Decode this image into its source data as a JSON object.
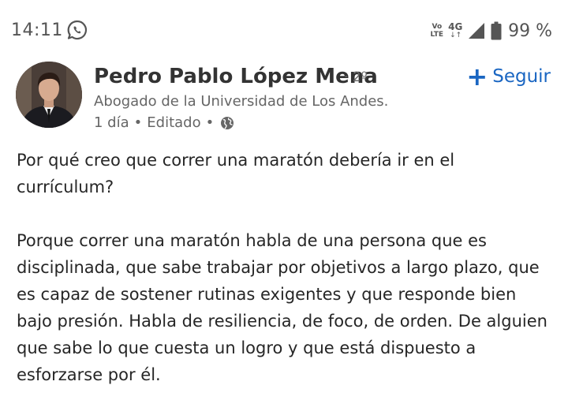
{
  "status_bar": {
    "time": "14:11",
    "network_volte": "Vo LTE",
    "network_type": "4G",
    "battery_percent": "99 %",
    "icons": [
      "whatsapp-icon",
      "signal-icon",
      "battery-icon"
    ]
  },
  "post": {
    "author": {
      "name": "Pedro Pablo López Mena",
      "connection_degree": "· 2º",
      "headline": "Abogado de la Universidad de Los Andes."
    },
    "meta": {
      "time": "1 día",
      "separator": "•",
      "edited": "Editado",
      "visibility_icon": "globe-icon"
    },
    "follow_button": {
      "icon": "plus-icon",
      "label": "Seguir"
    },
    "body": [
      "Por qué creo que correr una maratón debería ir en el currículum?",
      "Porque correr una maratón habla de una persona que es disciplinada, que sabe trabajar por objetivos a largo plazo, que es capaz de sostener rutinas exigentes y que responde bien bajo presión. Habla de resiliencia, de foco, de orden. De alguien que sabe lo que cuesta un logro y que está dispuesto a esforzarse por él."
    ]
  },
  "colors": {
    "accent": "#1a66c2",
    "text_primary": "#262626",
    "text_secondary": "#666666",
    "status_text": "#555555"
  }
}
